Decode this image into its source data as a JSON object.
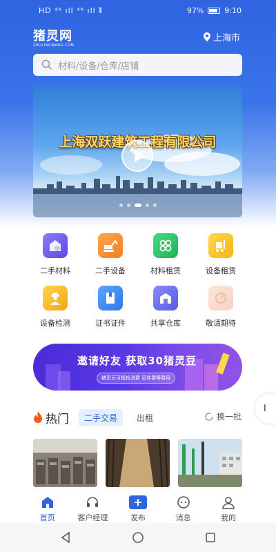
{
  "status_bar": {
    "left": "HD ⁴⁶ ıll ⁴⁶ ıll ⫴",
    "battery": "97%",
    "time": "9:10"
  },
  "header": {
    "logo_main": "猪灵网",
    "logo_sub": "ZHULINGWANG.COM",
    "city": "上海市"
  },
  "search": {
    "placeholder": "材料/设备/仓库/店铺"
  },
  "banner": {
    "title": "上海双跃建筑工程有限公司"
  },
  "categories": [
    {
      "label": "二手材料",
      "icon": "used-materials-icon",
      "color": "#6b5cf0"
    },
    {
      "label": "二手设备",
      "icon": "excavator-icon",
      "color": "#f68a2a"
    },
    {
      "label": "材料租赁",
      "icon": "pipes-icon",
      "color": "#2fc468"
    },
    {
      "label": "设备租赁",
      "icon": "forklift-icon",
      "color": "#f5c21c"
    },
    {
      "label": "设备检测",
      "icon": "inspector-icon",
      "color": "#f5b21c"
    },
    {
      "label": "证书证件",
      "icon": "certificate-icon",
      "color": "#3d8df2"
    },
    {
      "label": "共享仓库",
      "icon": "warehouse-icon",
      "color": "#6b6cf0"
    },
    {
      "label": "敬请期待",
      "icon": "coming-soon-icon",
      "color": "#f8d8c8"
    }
  ],
  "invite": {
    "title": "邀请好友 获取30猪灵豆",
    "subtitle": "猪灵豆可抵检测费   证件费等费用"
  },
  "hot": {
    "title": "热门",
    "tabs": [
      "二手交易",
      "出租"
    ],
    "refresh": "换一批"
  },
  "edge_handle": "I",
  "bottom_nav": [
    {
      "label": "首页",
      "icon": "home-icon",
      "active": true
    },
    {
      "label": "客户经理",
      "icon": "headset-icon",
      "active": false
    },
    {
      "label": "发布",
      "icon": "publish-icon",
      "active": false
    },
    {
      "label": "消息",
      "icon": "message-icon",
      "active": false
    },
    {
      "label": "我的",
      "icon": "profile-icon",
      "active": false
    }
  ],
  "colors": {
    "primary": "#2f63e0",
    "header_gradient_top": "#2f63e0",
    "invite_banner": "#5a3ae6"
  }
}
